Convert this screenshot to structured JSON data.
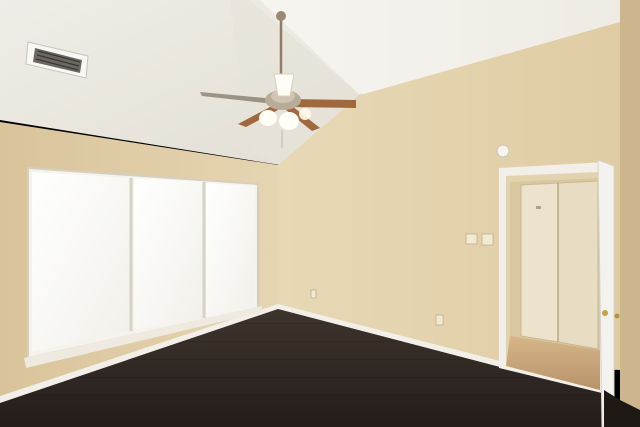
{
  "scene": {
    "description_items": [
      "ceiling-fan",
      "window",
      "doorway",
      "closet",
      "air-vent",
      "light-switch"
    ],
    "colors": {
      "wall_left": "#E2CFA9",
      "wall_right": "#E4D4B0",
      "wall_back": "#D8C39C",
      "ceiling_light": "#F6F3EC",
      "ceiling_shadow": "#DCD7CC",
      "floor_dark": "#2E2621",
      "floor_mid": "#3C322B",
      "baseboard": "#F2EFE8",
      "window_glow": "#FAFAF7",
      "door_white": "#F4F2EE",
      "closet_door": "#EDE2CB",
      "closet_floor": "#C9A77E",
      "fan_blade": "#A0683E"
    }
  }
}
